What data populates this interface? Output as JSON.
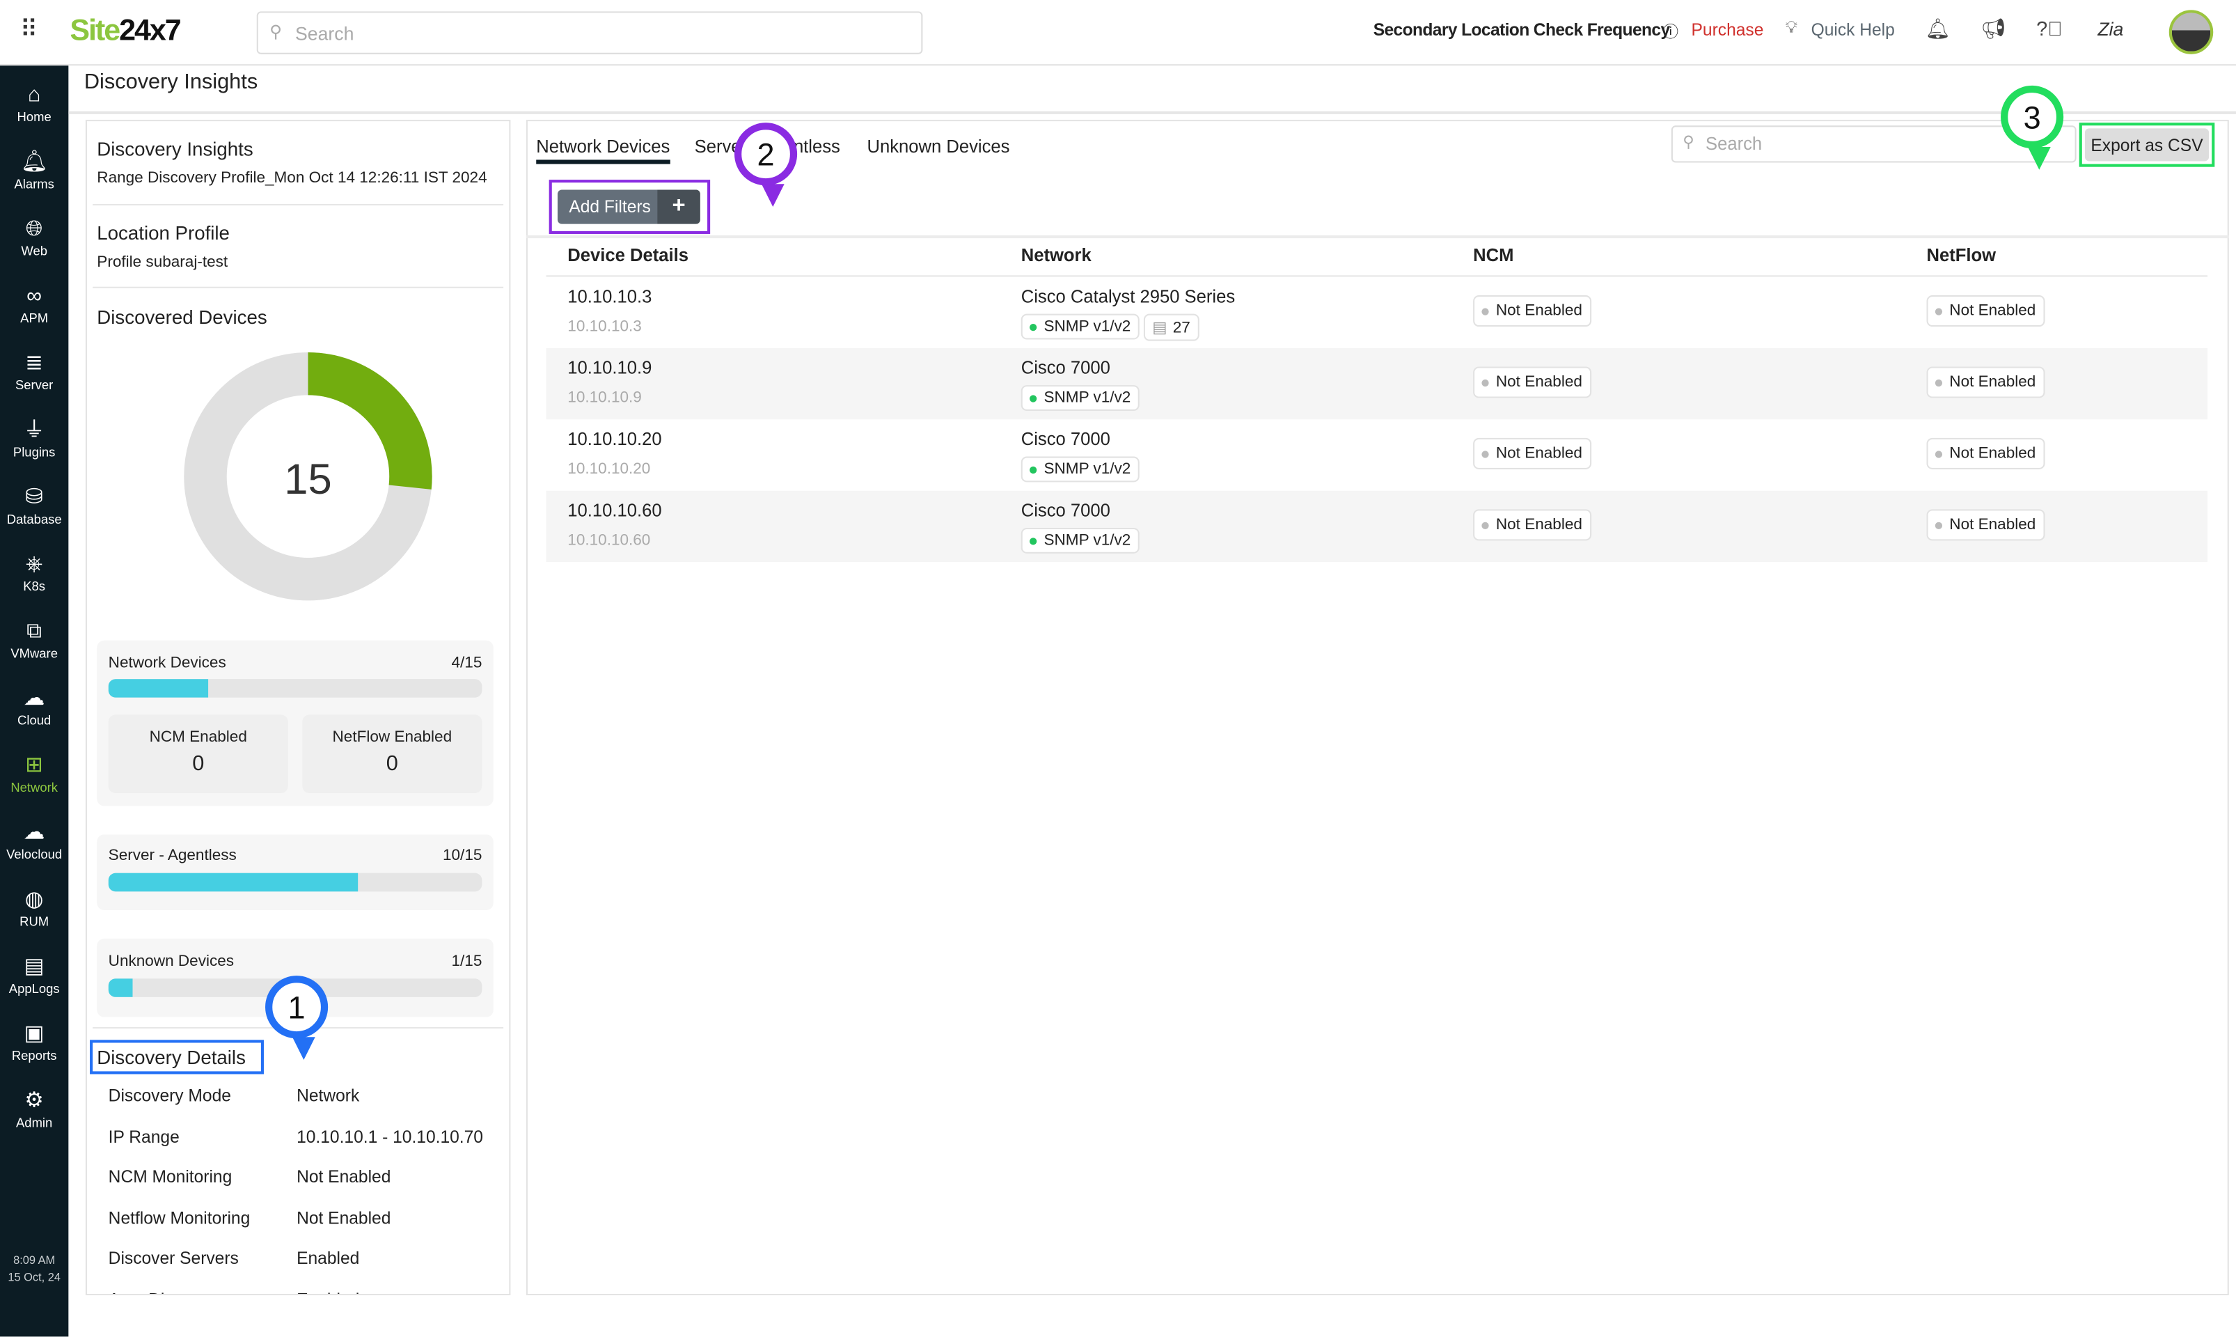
{
  "topbar": {
    "logo_site": "Site",
    "logo_num": "24x7",
    "search_placeholder": "Search",
    "secondary": "Secondary Location Check Frequency",
    "purchase": "Purchase",
    "quick_help": "Quick Help"
  },
  "sidebar": {
    "items": [
      {
        "label": "Home",
        "icon": "home"
      },
      {
        "label": "Alarms",
        "icon": "bell"
      },
      {
        "label": "Web",
        "icon": "globe"
      },
      {
        "label": "APM",
        "icon": "binoculars"
      },
      {
        "label": "Server",
        "icon": "server"
      },
      {
        "label": "Plugins",
        "icon": "plug"
      },
      {
        "label": "Database",
        "icon": "database"
      },
      {
        "label": "K8s",
        "icon": "helm"
      },
      {
        "label": "VMware",
        "icon": "vmware"
      },
      {
        "label": "Cloud",
        "icon": "cloud"
      },
      {
        "label": "Network",
        "icon": "network",
        "active": true
      },
      {
        "label": "Velocloud",
        "icon": "cloud-network"
      },
      {
        "label": "RUM",
        "icon": "globe-search"
      },
      {
        "label": "AppLogs",
        "icon": "log-search"
      },
      {
        "label": "Reports",
        "icon": "presentation"
      },
      {
        "label": "Admin",
        "icon": "gear"
      }
    ],
    "time": "8:09 AM",
    "date": "15 Oct, 24"
  },
  "page_title": "Discovery Insights",
  "left": {
    "insights_title": "Discovery Insights",
    "profile_name": "Range Discovery Profile_Mon Oct 14 12:26:11 IST 2024",
    "location_title": "Location Profile",
    "location_value": "Profile subaraj-test",
    "discovered_title": "Discovered Devices",
    "total": "15",
    "donut": {
      "total": 15,
      "highlight": 4,
      "highlight_color": "#72ad0f",
      "rest_color": "#e0e0e0"
    },
    "network": {
      "label": "Network Devices",
      "count": "4/15",
      "fraction": 0.2667,
      "ncm_label": "NCM Enabled",
      "ncm_value": "0",
      "netflow_label": "NetFlow Enabled",
      "netflow_value": "0"
    },
    "server": {
      "label": "Server - Agentless",
      "count": "10/15",
      "fraction": 0.6667
    },
    "unknown": {
      "label": "Unknown Devices",
      "count": "1/15",
      "fraction": 0.0667
    },
    "details_title": "Discovery Details",
    "details": [
      {
        "k": "Discovery Mode",
        "v": "Network"
      },
      {
        "k": "IP Range",
        "v": "10.10.10.1 - 10.10.10.70"
      },
      {
        "k": "NCM Monitoring",
        "v": "Not Enabled"
      },
      {
        "k": "Netflow Monitoring",
        "v": "Not Enabled"
      },
      {
        "k": "Discover Servers",
        "v": "Enabled"
      },
      {
        "k": "Auto Di...",
        "v": "Enabled"
      }
    ]
  },
  "right": {
    "tabs": [
      "Network Devices",
      "Server - Agentless",
      "Unknown Devices"
    ],
    "search_placeholder": "Search",
    "export": "Export as CSV",
    "add_filters": "Add Filters",
    "plus": "+",
    "columns": [
      "Device Details",
      "Network",
      "NCM",
      "NetFlow"
    ],
    "rows": [
      {
        "ip": "10.10.10.3",
        "sub": "10.10.10.3",
        "model": "Cisco Catalyst 2950 Series",
        "proto": "SNMP v1/v2",
        "ports": "27",
        "ncm": "Not Enabled",
        "netflow": "Not Enabled"
      },
      {
        "ip": "10.10.10.9",
        "sub": "10.10.10.9",
        "model": "Cisco 7000",
        "proto": "SNMP v1/v2",
        "ncm": "Not Enabled",
        "netflow": "Not Enabled"
      },
      {
        "ip": "10.10.10.20",
        "sub": "10.10.10.20",
        "model": "Cisco 7000",
        "proto": "SNMP v1/v2",
        "ncm": "Not Enabled",
        "netflow": "Not Enabled"
      },
      {
        "ip": "10.10.10.60",
        "sub": "10.10.10.60",
        "model": "Cisco 7000",
        "proto": "SNMP v1/v2",
        "ncm": "Not Enabled",
        "netflow": "Not Enabled"
      }
    ]
  },
  "annotations": [
    {
      "n": "1",
      "color": "#2370f5"
    },
    {
      "n": "2",
      "color": "#8a2be2"
    },
    {
      "n": "3",
      "color": "#22dd5e"
    }
  ]
}
